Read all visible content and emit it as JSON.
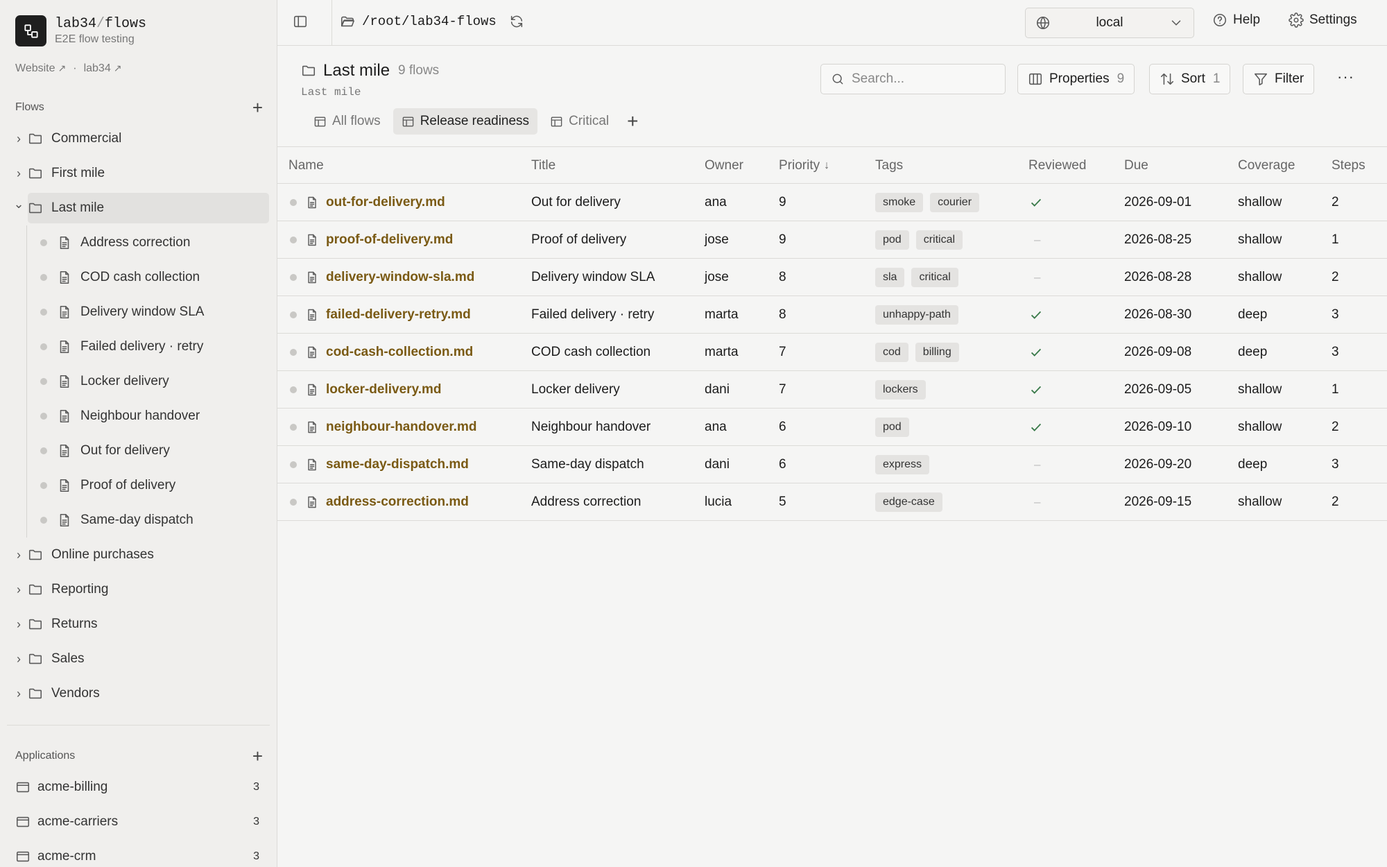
{
  "brand": {
    "org": "lab34",
    "sep": "/",
    "repo": "flows",
    "subtitle": "E2E flow testing"
  },
  "links": [
    {
      "label": "Website"
    },
    {
      "label": "lab34"
    }
  ],
  "flows_section": {
    "label": "Flows"
  },
  "tree": [
    {
      "label": "Commercial"
    },
    {
      "label": "First mile"
    },
    {
      "label": "Last mile",
      "expanded": true
    },
    {
      "label": "Online purchases"
    },
    {
      "label": "Reporting"
    },
    {
      "label": "Returns"
    },
    {
      "label": "Sales"
    },
    {
      "label": "Vendors"
    }
  ],
  "last_mile_children": [
    "Address correction",
    "COD cash collection",
    "Delivery window SLA",
    "Failed delivery · retry",
    "Locker delivery",
    "Neighbour handover",
    "Out for delivery",
    "Proof of delivery",
    "Same-day dispatch"
  ],
  "applications_section": {
    "label": "Applications"
  },
  "applications": [
    {
      "name": "acme-billing",
      "count": "3"
    },
    {
      "name": "acme-carriers",
      "count": "3"
    },
    {
      "name": "acme-crm",
      "count": "3"
    }
  ],
  "topbar": {
    "path": "/root/lab34-flows",
    "environment": "local",
    "help": "Help",
    "settings": "Settings"
  },
  "view": {
    "title": "Last mile",
    "count": "9 flows",
    "path": "Last mile",
    "search_placeholder": "Search...",
    "properties_label": "Properties",
    "properties_count": "9",
    "sort_label": "Sort",
    "sort_count": "1",
    "filter_label": "Filter",
    "more": "···"
  },
  "tabs": [
    {
      "label": "All flows",
      "active": false
    },
    {
      "label": "Release readiness",
      "active": true
    },
    {
      "label": "Critical",
      "active": false
    }
  ],
  "columns": {
    "name": "Name",
    "title": "Title",
    "owner": "Owner",
    "priority": "Priority",
    "tags": "Tags",
    "reviewed": "Reviewed",
    "due": "Due",
    "coverage": "Coverage",
    "steps": "Steps"
  },
  "colors": {
    "accent_link": "#7a5a14",
    "check": "#3a7a4a"
  },
  "rows": [
    {
      "file": "out-for-delivery.md",
      "title": "Out for delivery",
      "owner": "ana",
      "priority": "9",
      "tags": [
        "smoke",
        "courier"
      ],
      "reviewed": true,
      "due": "2026-09-01",
      "coverage": "shallow",
      "steps": "2"
    },
    {
      "file": "proof-of-delivery.md",
      "title": "Proof of delivery",
      "owner": "jose",
      "priority": "9",
      "tags": [
        "pod",
        "critical"
      ],
      "reviewed": false,
      "due": "2026-08-25",
      "coverage": "shallow",
      "steps": "1"
    },
    {
      "file": "delivery-window-sla.md",
      "title": "Delivery window SLA",
      "owner": "jose",
      "priority": "8",
      "tags": [
        "sla",
        "critical"
      ],
      "reviewed": false,
      "due": "2026-08-28",
      "coverage": "shallow",
      "steps": "2"
    },
    {
      "file": "failed-delivery-retry.md",
      "title": "Failed delivery · retry",
      "owner": "marta",
      "priority": "8",
      "tags": [
        "unhappy-path"
      ],
      "reviewed": true,
      "due": "2026-08-30",
      "coverage": "deep",
      "steps": "3"
    },
    {
      "file": "cod-cash-collection.md",
      "title": "COD cash collection",
      "owner": "marta",
      "priority": "7",
      "tags": [
        "cod",
        "billing"
      ],
      "reviewed": true,
      "due": "2026-09-08",
      "coverage": "deep",
      "steps": "3"
    },
    {
      "file": "locker-delivery.md",
      "title": "Locker delivery",
      "owner": "dani",
      "priority": "7",
      "tags": [
        "lockers"
      ],
      "reviewed": true,
      "due": "2026-09-05",
      "coverage": "shallow",
      "steps": "1"
    },
    {
      "file": "neighbour-handover.md",
      "title": "Neighbour handover",
      "owner": "ana",
      "priority": "6",
      "tags": [
        "pod"
      ],
      "reviewed": true,
      "due": "2026-09-10",
      "coverage": "shallow",
      "steps": "2"
    },
    {
      "file": "same-day-dispatch.md",
      "title": "Same-day dispatch",
      "owner": "dani",
      "priority": "6",
      "tags": [
        "express"
      ],
      "reviewed": false,
      "due": "2026-09-20",
      "coverage": "deep",
      "steps": "3"
    },
    {
      "file": "address-correction.md",
      "title": "Address correction",
      "owner": "lucia",
      "priority": "5",
      "tags": [
        "edge-case"
      ],
      "reviewed": false,
      "due": "2026-09-15",
      "coverage": "shallow",
      "steps": "2"
    }
  ]
}
